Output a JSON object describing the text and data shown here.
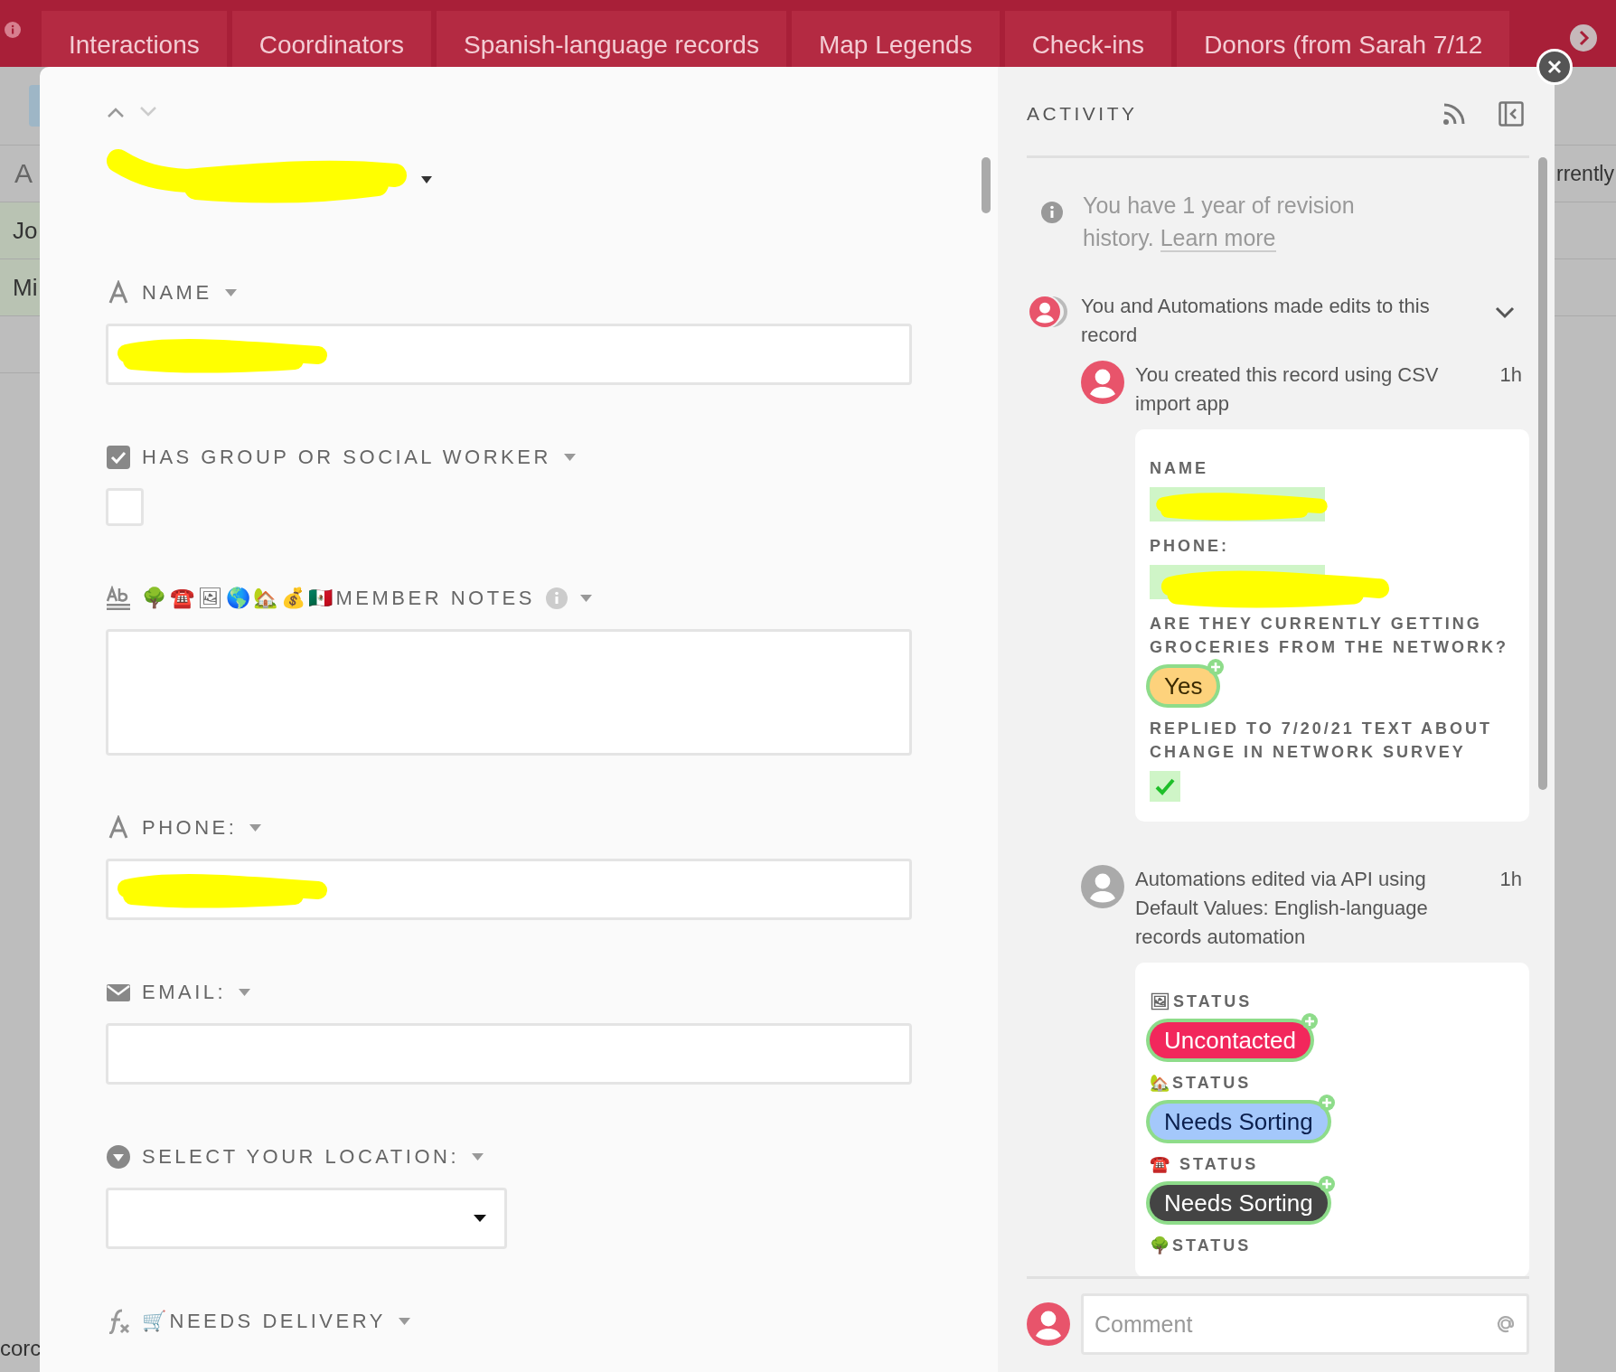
{
  "top_tabs": [
    {
      "label": "Interactions"
    },
    {
      "label": "Coordinators"
    },
    {
      "label": "Spanish-language records"
    },
    {
      "label": "Map Legends"
    },
    {
      "label": "Check-ins"
    },
    {
      "label": "Donors (from Sarah 7/12"
    }
  ],
  "background_table": {
    "header": "A",
    "rows": [
      "Jo",
      "Mi"
    ],
    "column_2_header": "rrently",
    "footer": "corc"
  },
  "record": {
    "title_redacted": true,
    "fields": [
      {
        "kind": "text",
        "label": "NAME",
        "redacted": true
      },
      {
        "kind": "checkbox",
        "label": "HAS GROUP OR SOCIAL WORKER",
        "checked": false
      },
      {
        "kind": "long_text",
        "label": "🌳☎️🖼🌎🏡💰🇲🇽MEMBER NOTES",
        "info": true
      },
      {
        "kind": "text",
        "label": "PHONE:",
        "redacted": true
      },
      {
        "kind": "email",
        "label": "EMAIL:"
      },
      {
        "kind": "select",
        "label": "SELECT YOUR LOCATION:"
      },
      {
        "kind": "formula",
        "label": "🛒NEEDS DELIVERY"
      }
    ]
  },
  "activity": {
    "title": "ACTIVITY",
    "notice": {
      "text": "You have 1 year of revision history.",
      "link": "Learn more"
    },
    "group": {
      "text": "You and Automations made edits to this record",
      "expanded": true,
      "entries": [
        {
          "kind": "user",
          "text": "You created this record using CSV import app",
          "time": "1h",
          "changes": [
            {
              "kind": "text",
              "label": "NAME",
              "redacted": true,
              "added": true
            },
            {
              "kind": "text",
              "label": "PHONE:",
              "redacted": true,
              "added": true
            },
            {
              "kind": "choice",
              "label": "ARE THEY CURRENTLY GETTING GROCERIES FROM THE NETWORK?",
              "choices": [
                {
                  "text": "Yes",
                  "color": "#fdd27c",
                  "added": true
                }
              ]
            },
            {
              "kind": "checkbox",
              "label": "REPLIED TO 7/20/21 TEXT ABOUT CHANGE IN NETWORK SURVEY",
              "checked": true,
              "added": true
            }
          ]
        },
        {
          "kind": "automation",
          "text": "Automations edited via API using Default Values: English-language records automation",
          "time": "1h",
          "changes": [
            {
              "kind": "choice",
              "label": "🖼STATUS",
              "choices": [
                {
                  "text": "Uncontacted",
                  "color": "#f2275c",
                  "added": true
                }
              ]
            },
            {
              "kind": "choice",
              "label": "🏡STATUS",
              "choices": [
                {
                  "text": "Needs Sorting",
                  "color": "#a4c8fb",
                  "added": true
                }
              ]
            },
            {
              "kind": "choice",
              "label": "☎️ STATUS",
              "choices": [
                {
                  "text": "Needs Sorting",
                  "color": "#444444",
                  "added": true
                }
              ]
            },
            {
              "kind": "choice",
              "label": "🌳STATUS"
            }
          ]
        }
      ]
    },
    "comment": {
      "placeholder": "Comment"
    }
  }
}
